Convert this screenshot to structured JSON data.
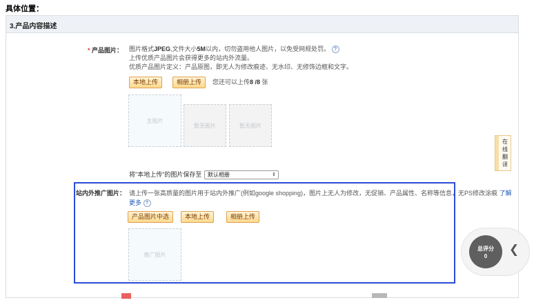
{
  "heading": "具体位置：",
  "section": {
    "title": "3.产品内容描述"
  },
  "product_images": {
    "star": "*",
    "label": "产品图片：",
    "desc_line1_pre": "图片格式",
    "desc_line1_fmt": "JPEG",
    "desc_line1_mid": ",文件大小",
    "desc_line1_size": "5M",
    "desc_line1_post": "以内，切勿盗用他人图片，以免受网规处罚。",
    "desc_line2": "上传优质产品图片会获得更多的站内外流量。",
    "desc_line3": "优质产品图片定义：产品原图，即无人为修改痕迹、无水印、无修饰边框和文字。",
    "btn_local": "本地上传",
    "btn_album": "相册上传",
    "remaining_pre": "您还可以上传",
    "remaining_count": "8 /8",
    "remaining_post": " 张",
    "slot_main": "主图片",
    "slot_empty1": "暂无图片",
    "slot_empty2": "暂无图片",
    "save_label": "将\"本地上传\"的图片保存至",
    "save_select": "默认相册"
  },
  "promo_image": {
    "label": "站内外推广图片：",
    "desc_main": "请上传一张高质量的图片用于站内外推广(例如google shopping)，图片上无人为修改，无促销、产品属性、名称等信息，无PS修改涂痕",
    "learn_a": "了解",
    "learn_b": "更多",
    "btn_from_product": "产品图片中选",
    "btn_local": "本地上传",
    "btn_album": "相册上传",
    "slot_promo": "推广图片"
  },
  "translate": {
    "label": "在线翻译"
  },
  "score": {
    "title": "总评分",
    "value": "0"
  },
  "icons": {
    "help": "question-circle-icon",
    "collapse": "chevron-left-icon"
  },
  "colors": {
    "highlight": "#2b4bd6",
    "button_bg": "#fcd98e",
    "star": "#e4393c",
    "link": "#1f57b8"
  }
}
